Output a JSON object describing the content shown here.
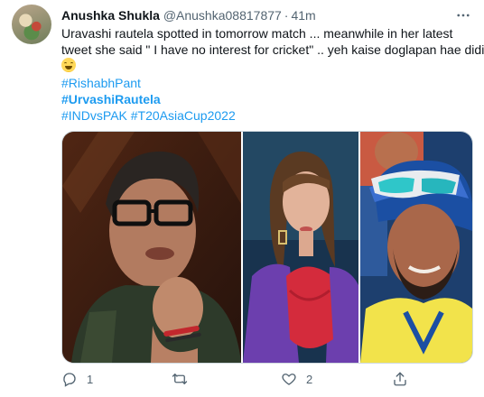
{
  "author": {
    "name": "Anushka Shukla",
    "handle": "@Anushka08817877",
    "separator": "·",
    "time": "41m"
  },
  "body": {
    "line1": "Uravashi rautela spotted in tomorrow match ... meanwhile in her latest",
    "line2": "tweet she said \" I have no interest for cricket\" .. yeh kaise doglapan hae didi",
    "emoji": "grinning-sweat-emoji"
  },
  "hashtags": {
    "line1": "#RishabhPant",
    "line2": "#UrvashiRautela",
    "line3": "#INDvsPAK #T20AsiaCup2022"
  },
  "media": {
    "panels": [
      "man-with-glasses-photo",
      "woman-in-purple-photo",
      "cricketer-with-sunglasses-photo"
    ]
  },
  "actions": {
    "reply_icon": "reply-icon",
    "reply_count": "1",
    "retweet_icon": "retweet-icon",
    "retweet_count": "",
    "like_icon": "heart-icon",
    "like_count": "2",
    "share_icon": "share-icon"
  },
  "colors": {
    "link": "#1d9bf0",
    "secondary_text": "#536471",
    "primary_text": "#0f1419",
    "border": "#cfd9de"
  }
}
